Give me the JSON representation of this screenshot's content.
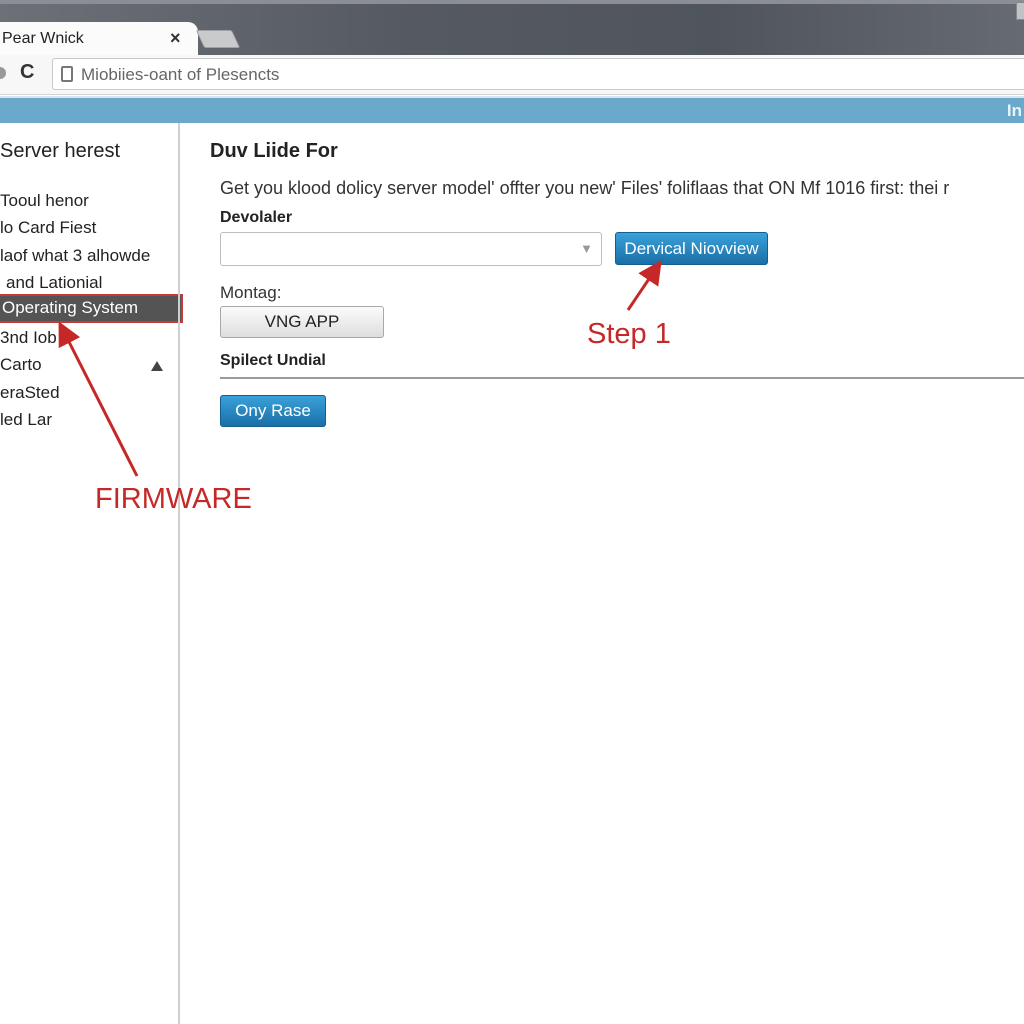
{
  "browser": {
    "tab_title": "Pear Wnick",
    "tab_close": "×",
    "url": "Miobiies-oant of Plesencts",
    "reload_glyph": "C",
    "bluebar_text": "In"
  },
  "sidebar": {
    "title": "Server herest",
    "items": [
      {
        "label": "Tooul henor"
      },
      {
        "label": "lo Card Fiest"
      },
      {
        "label": "laof what 3 alhowde"
      },
      {
        "label": "and Lationial"
      },
      {
        "label": "Operating System",
        "selected": true
      },
      {
        "label": "3nd Iob"
      },
      {
        "label": "Carto"
      },
      {
        "label": "eraSted"
      },
      {
        "label": "led Lar"
      }
    ]
  },
  "main": {
    "heading": "Duv Liide For",
    "description": "Get you klood dolicy server model' offter you new' Files' foliflaas that ON Mf 1016 first: thei r",
    "dropdown_label": "Devolaler",
    "dropdown_value": "",
    "primary_button": "Dervical Niovview",
    "montag_label": "Montag:",
    "app_button": "VNG APP",
    "section_title": "Spilect Undial",
    "secondary_button": "Ony Rase"
  },
  "annotations": {
    "step1": "Step 1",
    "firmware": "FIRMWARE",
    "color": "#c62828"
  }
}
